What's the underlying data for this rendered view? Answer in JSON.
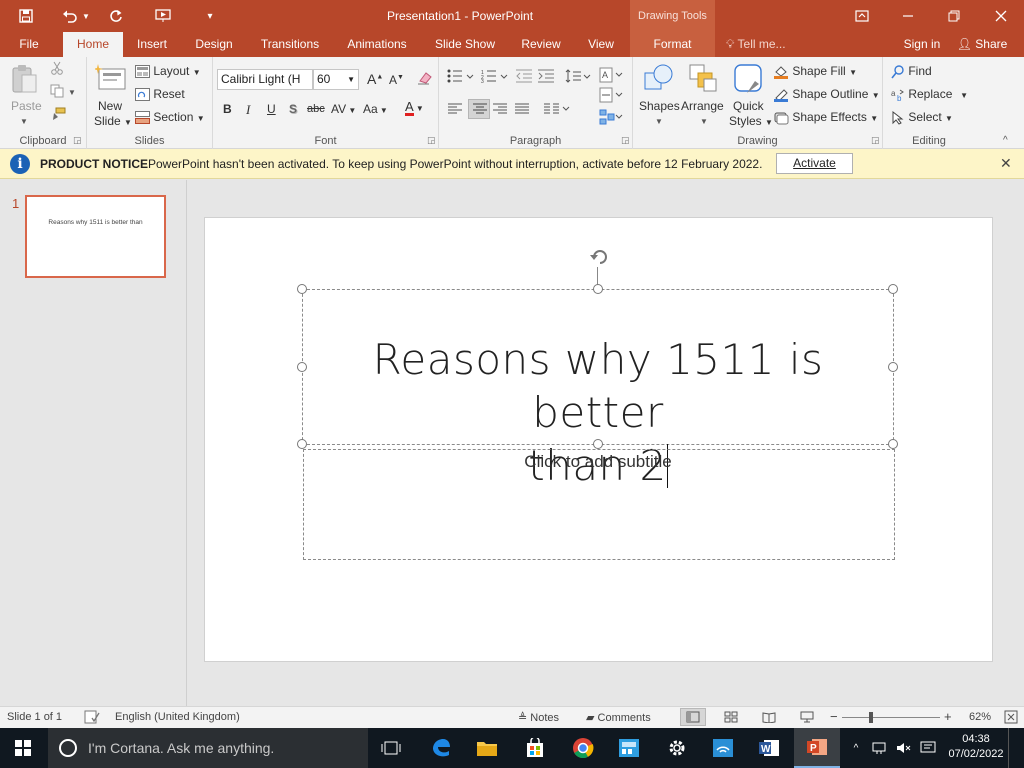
{
  "titlebar": {
    "title": "Presentation1 - PowerPoint",
    "context_tab": "Drawing Tools"
  },
  "tabs": [
    "File",
    "Home",
    "Insert",
    "Design",
    "Transitions",
    "Animations",
    "Slide Show",
    "Review",
    "View",
    "Format"
  ],
  "tell_me": "Tell me...",
  "sign_in": "Sign in",
  "share": "Share",
  "ribbon": {
    "clipboard": {
      "label": "Clipboard",
      "paste": "Paste"
    },
    "slides": {
      "label": "Slides",
      "new_slide_1": "New",
      "new_slide_2": "Slide",
      "layout": "Layout",
      "reset": "Reset",
      "section": "Section"
    },
    "font": {
      "label": "Font",
      "name": "Calibri Light (H",
      "size": "60",
      "bold": "B",
      "italic": "I",
      "underline": "U",
      "shadow": "S",
      "strike": "abc",
      "spacing": "AV",
      "case": "Aa"
    },
    "paragraph": {
      "label": "Paragraph"
    },
    "drawing": {
      "label": "Drawing",
      "shapes": "Shapes",
      "arrange": "Arrange",
      "quick_styles_1": "Quick",
      "quick_styles_2": "Styles",
      "shape_fill": "Shape Fill",
      "shape_outline": "Shape Outline",
      "shape_effects": "Shape Effects"
    },
    "editing": {
      "label": "Editing",
      "find": "Find",
      "replace": "Replace",
      "select": "Select"
    }
  },
  "notice": {
    "heading": "PRODUCT NOTICE",
    "message": "PowerPoint hasn't been activated. To keep using PowerPoint without interruption, activate before 12 February 2022.",
    "action": "Activate"
  },
  "thumbnails": [
    {
      "number": "1",
      "text": "Reasons why 1511 is better than"
    }
  ],
  "slide": {
    "title_line1": "Reasons why 1511 is better",
    "title_line2": "than 2",
    "subtitle_placeholder": "Click to add subtitle"
  },
  "status": {
    "slide_of": "Slide 1 of 1",
    "language": "English (United Kingdom)",
    "notes": "Notes",
    "comments": "Comments",
    "zoom": "62%"
  },
  "taskbar": {
    "cortana": "I'm Cortana. Ask me anything.",
    "time": "04:38",
    "date": "07/02/2022"
  },
  "colors": {
    "accent": "#b7472a",
    "notice_bg": "#fdf5c8"
  }
}
